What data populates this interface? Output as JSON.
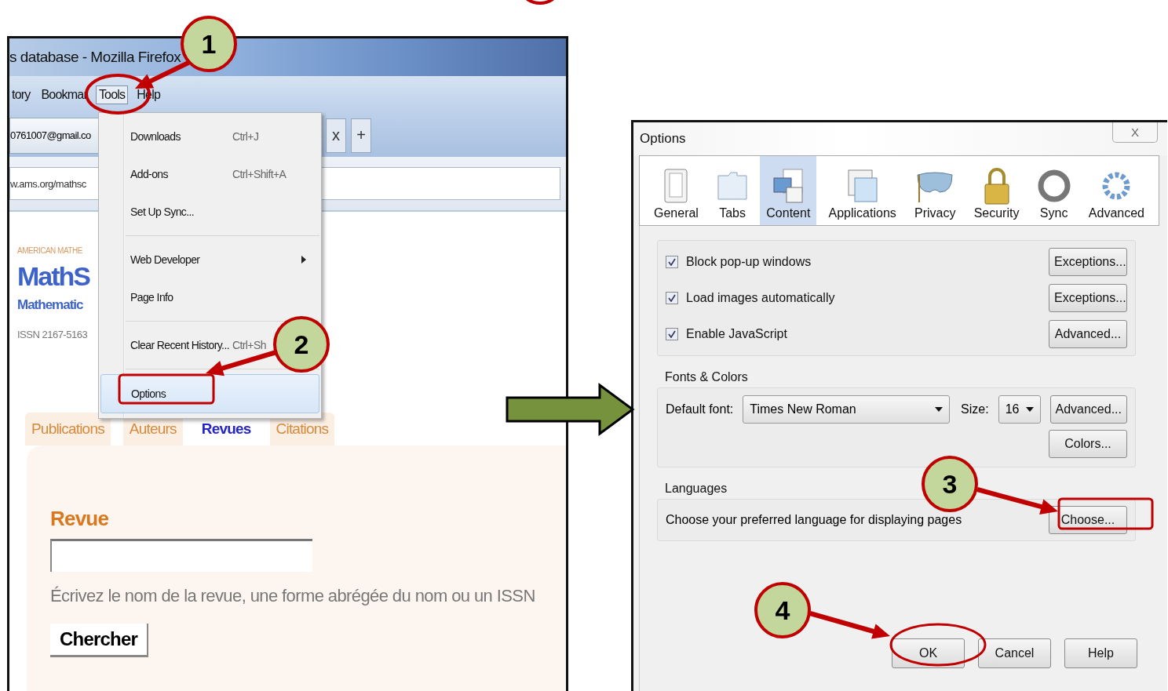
{
  "browser": {
    "title": "s database - Mozilla Firefox",
    "menu_bar": [
      {
        "label": "tory",
        "selected": false
      },
      {
        "label": "Bookmar",
        "selected": false
      },
      {
        "label": "Tools",
        "selected": true
      },
      {
        "label": "Help",
        "selected": false
      }
    ],
    "tab": {
      "label": "0761007@gmail.co"
    },
    "tab_buttons": [
      "x",
      "+"
    ],
    "url": "w.ams.org/mathsc",
    "tools_menu": [
      {
        "kind": "item",
        "label": "Downloads",
        "shortcut": "Ctrl+J",
        "highlighted": false
      },
      {
        "kind": "item",
        "label": "Add-ons",
        "shortcut": "Ctrl+Shift+A",
        "highlighted": false
      },
      {
        "kind": "item",
        "label": "Set Up Sync...",
        "highlighted": false
      },
      {
        "kind": "separator"
      },
      {
        "kind": "submenu",
        "label": "Web Developer",
        "highlighted": false
      },
      {
        "kind": "item",
        "label": "Page Info",
        "highlighted": false
      },
      {
        "kind": "separator"
      },
      {
        "kind": "item",
        "label": "Clear Recent History...",
        "shortcut": "Ctrl+Sh",
        "highlighted": false
      },
      {
        "kind": "separator"
      },
      {
        "kind": "item",
        "label": "Options",
        "highlighted": true
      }
    ],
    "page": {
      "publisher": "AMERICAN MATHE",
      "logo": "MathS",
      "subtitle": "Mathematic",
      "issn": "ISSN 2167-5163",
      "tabs": [
        {
          "label": "Publications",
          "selected": false
        },
        {
          "label": "Auteurs",
          "selected": false
        },
        {
          "label": "Revues",
          "selected": true
        },
        {
          "label": "Citations",
          "selected": false
        }
      ],
      "field_label": "Revue",
      "hint": "Écrivez le nom de la revue, une forme abrégée du nom ou un ISSN",
      "button": "Chercher"
    }
  },
  "options_dialog": {
    "title": "Options",
    "close": "X",
    "tabs": [
      {
        "label": "General",
        "selected": false
      },
      {
        "label": "Tabs",
        "selected": false
      },
      {
        "label": "Content",
        "selected": true
      },
      {
        "label": "Applications",
        "selected": false
      },
      {
        "label": "Privacy",
        "selected": false
      },
      {
        "label": "Security",
        "selected": false
      },
      {
        "label": "Sync",
        "selected": false
      },
      {
        "label": "Advanced",
        "selected": false
      }
    ],
    "checkboxes": [
      {
        "label": "Block pop-up windows",
        "checked": true,
        "button": "Exceptions..."
      },
      {
        "label": "Load images automatically",
        "checked": true,
        "button": "Exceptions..."
      },
      {
        "label": "Enable JavaScript",
        "checked": true,
        "button": "Advanced..."
      }
    ],
    "fonts": {
      "legend": "Fonts & Colors",
      "font_label": "Default font:",
      "font_value": "Times New Roman",
      "size_label": "Size:",
      "size_value": "16",
      "buttons": [
        "Advanced...",
        "Colors..."
      ]
    },
    "languages": {
      "legend": "Languages",
      "text": "Choose your preferred language for displaying pages",
      "button": "Choose..."
    },
    "buttons": [
      "OK",
      "Cancel",
      "Help"
    ]
  },
  "callouts": [
    {
      "number": "1"
    },
    {
      "number": "2"
    },
    {
      "number": "3"
    },
    {
      "number": "4"
    }
  ]
}
